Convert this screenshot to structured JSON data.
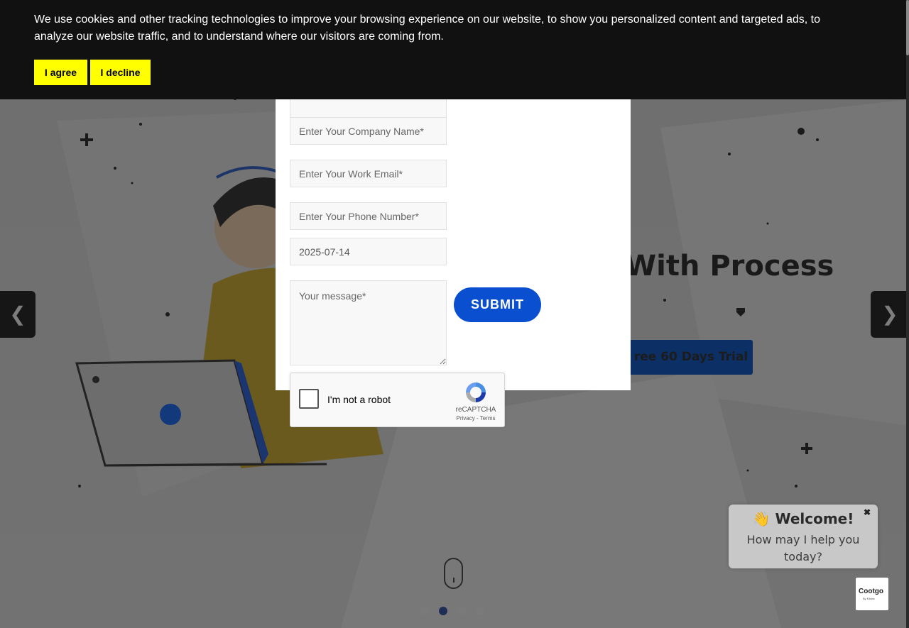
{
  "cookie_banner": {
    "message": "We use cookies and other tracking technologies to improve your browsing experience on our website, to show you personalized content and targeted ads, to analyze our website traffic, and to understand where our visitors are coming from.",
    "agree_label": "I agree",
    "decline_label": "I decline"
  },
  "hero": {
    "title_fragment": "With Process",
    "cta_fragment": "ree 60 Days Trial"
  },
  "slider": {
    "prev_label": "❮",
    "next_label": "❯",
    "dots_count": 4,
    "active_dot": 1
  },
  "form": {
    "company_placeholder": "Enter Your Company Name*",
    "email_placeholder": "Enter Your Work Email*",
    "phone_placeholder": "Enter Your Phone Number*",
    "date_value": "2025-07-14",
    "message_placeholder": "Your message*",
    "submit_label": "SUBMIT"
  },
  "recaptcha": {
    "label": "I'm not a robot",
    "brand": "reCAPTCHA",
    "links": "Privacy - Terms"
  },
  "chat": {
    "title": "👋 Welcome!",
    "subtitle": "How may I help you today?",
    "close_label": "✖",
    "launcher_logo": "Cootgo",
    "launcher_sub": "By Ellabs"
  },
  "colors": {
    "cookie_button": "#ffff00",
    "submit": "#0b4fd1",
    "cookie_bar": "#111111"
  }
}
